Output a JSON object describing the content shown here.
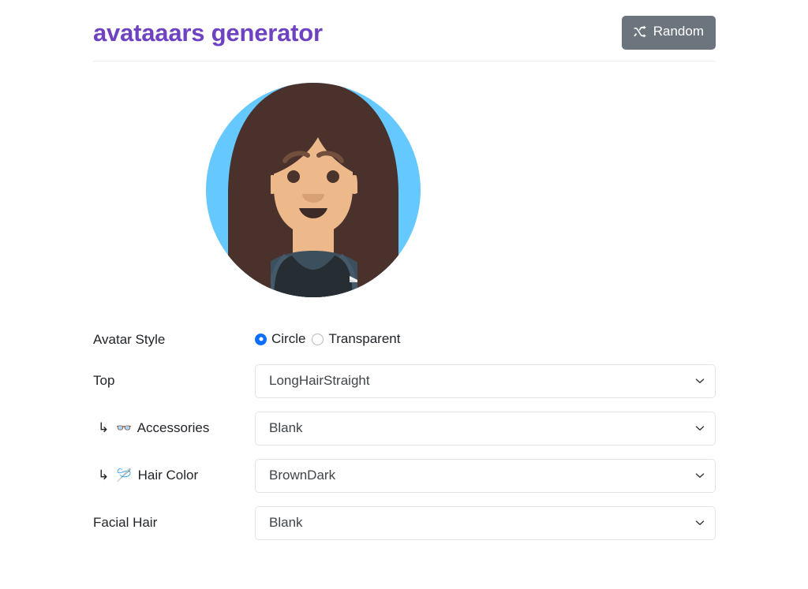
{
  "header": {
    "title": "avataaars generator",
    "random_button": {
      "label": "Random",
      "icon": "shuffle-icon",
      "bg_color": "#6c757d"
    },
    "title_color": "#6f42c1"
  },
  "avatar": {
    "style": "Circle",
    "background_color": "#65c9ff",
    "skin_color": "#edb98a",
    "hair_color": "#4a312c",
    "shirt_color": "#262e33",
    "blazer_color": "#3c4f5c",
    "mouth_color": "#3b2a25"
  },
  "form": {
    "avatar_style": {
      "label": "Avatar Style",
      "options": [
        {
          "label": "Circle",
          "selected": true
        },
        {
          "label": "Transparent",
          "selected": false
        }
      ],
      "accent_color": "#0d6efd"
    },
    "fields": [
      {
        "label": "Top",
        "sub": false,
        "emoji": "",
        "value": "LongHairStraight"
      },
      {
        "label": "Accessories",
        "sub": true,
        "emoji": "👓",
        "value": "Blank"
      },
      {
        "label": "Hair Color",
        "sub": true,
        "emoji": "🪡",
        "value": "BrownDark"
      },
      {
        "label": "Facial Hair",
        "sub": false,
        "emoji": "",
        "value": "Blank"
      }
    ],
    "sub_arrow": "↳"
  }
}
